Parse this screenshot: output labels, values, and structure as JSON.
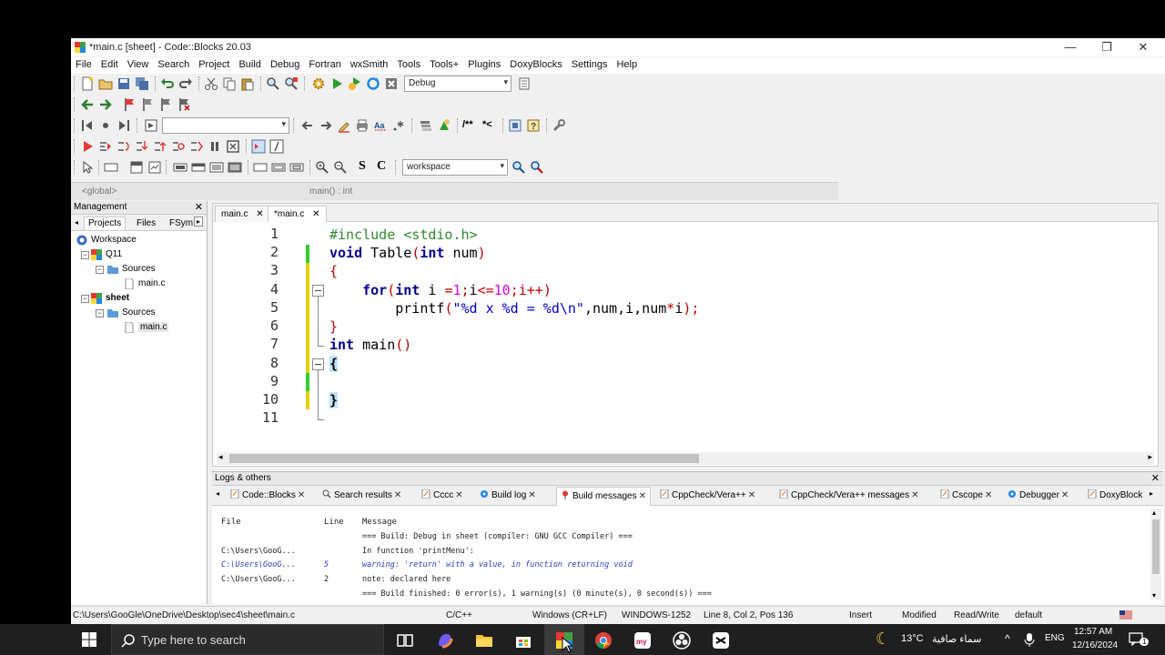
{
  "window": {
    "title": "*main.c [sheet] - Code::Blocks 20.03",
    "controls": {
      "minimize": "—",
      "maximize": "❐",
      "close": "✕"
    }
  },
  "menu": [
    "File",
    "Edit",
    "View",
    "Search",
    "Project",
    "Build",
    "Debug",
    "Fortran",
    "wxSmith",
    "Tools",
    "Tools+",
    "Plugins",
    "DoxyBlocks",
    "Settings",
    "Help"
  ],
  "toolbar": {
    "build_target": "Debug",
    "search_combo": "workspace",
    "bold_s": "S",
    "bold_c": "C",
    "comment_block": "/**",
    "comment_line": "*<"
  },
  "scope": {
    "global": "<global>",
    "function": "main() : int"
  },
  "management": {
    "title": "Management",
    "close": "✕",
    "tabs": [
      "Projects",
      "Files",
      "FSym"
    ],
    "tree": [
      {
        "label": "Workspace",
        "level": 0,
        "bold": false
      },
      {
        "label": "Q11",
        "level": 1,
        "bold": false
      },
      {
        "label": "Sources",
        "level": 2,
        "bold": false
      },
      {
        "label": "main.c",
        "level": 3,
        "bold": false
      },
      {
        "label": "sheet",
        "level": 1,
        "bold": true
      },
      {
        "label": "Sources",
        "level": 2,
        "bold": false
      },
      {
        "label": "main.c",
        "level": 3,
        "bold": false
      }
    ]
  },
  "editor": {
    "tabs": [
      {
        "label": "main.c",
        "close": "✕"
      },
      {
        "label": "*main.c",
        "close": "✕"
      }
    ],
    "line_numbers": [
      "1",
      "2",
      "3",
      "4",
      "5",
      "6",
      "7",
      "8",
      "9",
      "10",
      "11"
    ],
    "code": {
      "l1": "#include <stdio.h>",
      "l2_kw": "void",
      "l2_name": " Table",
      "l2_open": "(",
      "l2_kw2": "int",
      "l2_arg": " num",
      "l2_close": ")",
      "l3": "{",
      "l4_indent": "    ",
      "l4_kw": "for",
      "l4_open": "(",
      "l4_kw2": "int",
      "l4_var": " i ",
      "l4_eq": "=",
      "l4_n1": "1",
      "l4_semi1": ";",
      "l4_i": "i",
      "l4_le": "<=",
      "l4_n10": "10",
      "l4_semi2": ";",
      "l4_inc": "i++",
      "l4_close": ")",
      "l5_indent": "        ",
      "l5_fn": "printf",
      "l5_open": "(",
      "l5_str": "\"%d x %d = %d\\n\"",
      "l5_args1": ",num,i,num",
      "l5_star": "*",
      "l5_args2": "i",
      "l5_close": ");",
      "l6": "}",
      "l7_kw": "int",
      "l7_name": " main",
      "l7_paren": "()",
      "l8": "{",
      "l10": "}"
    }
  },
  "logs": {
    "title": "Logs & others",
    "close": "✕",
    "tabs": [
      "Code::Blocks",
      "Search results",
      "Cccc",
      "Build log",
      "Build messages",
      "CppCheck/Vera++",
      "CppCheck/Vera++ messages",
      "Cscope",
      "Debugger",
      "DoxyBlock"
    ],
    "tab_close": "✕",
    "columns": [
      "File",
      "Line",
      "Message"
    ],
    "rows": [
      {
        "file": "",
        "line": "",
        "message": "=== Build: Debug in sheet (compiler: GNU GCC Compiler) ===",
        "warn": false
      },
      {
        "file": "C:\\Users\\GooG...",
        "line": "",
        "message": "In function 'printMenu':",
        "warn": false
      },
      {
        "file": "C:\\Users\\GooG...",
        "line": "5",
        "message": "warning: 'return' with a value, in function returning void",
        "warn": true
      },
      {
        "file": "C:\\Users\\GooG...",
        "line": "2",
        "message": "note: declared here",
        "warn": false
      },
      {
        "file": "",
        "line": "",
        "message": "=== Build finished: 0 error(s), 1 warning(s) (0 minute(s), 0 second(s)) ===",
        "warn": false
      }
    ]
  },
  "status": {
    "path": "C:\\Users\\GooGle\\OneDrive\\Desktop\\sec4\\sheet\\main.c",
    "language": "C/C++",
    "eol": "Windows (CR+LF)",
    "encoding": "WINDOWS-1252",
    "position": "Line 8, Col 2, Pos 136",
    "mode": "Insert",
    "modified": "Modified",
    "access": "Read/Write",
    "profile": "default"
  },
  "taskbar": {
    "search_placeholder": "Type here to search",
    "weather_temp": "13°C",
    "weather_text": "سماء صافية",
    "language": "ENG",
    "time": "12:57 AM",
    "date": "12/16/2024",
    "notif_count": "1"
  },
  "colors": {
    "preprocessor": "#2e8b2e",
    "keyword": "#00008b",
    "operator": "#c00000",
    "number": "#e000e0",
    "string": "#0000c8",
    "change_marker_saved": "#33cc33",
    "change_marker_unsaved": "#e8d000"
  }
}
